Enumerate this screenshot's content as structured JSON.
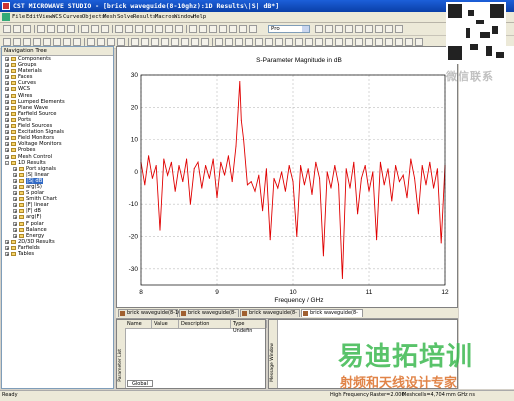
{
  "window": {
    "title": "CST MICROWAVE STUDIO - [brick waveguide(8-10ghz):1D Results\\|S| dB*]"
  },
  "menu": {
    "items": [
      "File",
      "Edit",
      "View",
      "WCS",
      "Curves",
      "Objects",
      "Mesh",
      "Solve",
      "Results",
      "Macros",
      "Window",
      "Help"
    ]
  },
  "toolbar": {
    "selector_value": "Pro"
  },
  "nav": {
    "title": "Navigation Tree",
    "items": [
      {
        "label": "Components",
        "expanded": false,
        "indent": 0,
        "icon": "folder-icon"
      },
      {
        "label": "Groups",
        "expanded": false,
        "indent": 0,
        "icon": "folder-icon"
      },
      {
        "label": "Materials",
        "expanded": false,
        "indent": 0,
        "icon": "folder-icon"
      },
      {
        "label": "Faces",
        "expanded": false,
        "indent": 0,
        "icon": "folder-icon"
      },
      {
        "label": "Curves",
        "expanded": false,
        "indent": 0,
        "icon": "folder-icon"
      },
      {
        "label": "WCS",
        "expanded": false,
        "indent": 0,
        "icon": "folder-icon"
      },
      {
        "label": "Wires",
        "expanded": false,
        "indent": 0,
        "icon": "folder-icon"
      },
      {
        "label": "Lumped Elements",
        "expanded": false,
        "indent": 0,
        "icon": "folder-icon"
      },
      {
        "label": "Plane Wave",
        "expanded": false,
        "indent": 0,
        "icon": "folder-icon"
      },
      {
        "label": "Farfield Source",
        "expanded": false,
        "indent": 0,
        "icon": "folder-icon"
      },
      {
        "label": "Ports",
        "expanded": false,
        "indent": 0,
        "icon": "folder-icon"
      },
      {
        "label": "Field Sources",
        "expanded": false,
        "indent": 0,
        "icon": "folder-icon"
      },
      {
        "label": "Excitation Signals",
        "expanded": false,
        "indent": 0,
        "icon": "folder-icon"
      },
      {
        "label": "Field Monitors",
        "expanded": false,
        "indent": 0,
        "icon": "folder-icon"
      },
      {
        "label": "Voltage Monitors",
        "expanded": false,
        "indent": 0,
        "icon": "folder-icon"
      },
      {
        "label": "Probes",
        "expanded": false,
        "indent": 0,
        "icon": "folder-icon"
      },
      {
        "label": "Mesh Control",
        "expanded": false,
        "indent": 0,
        "icon": "folder-icon"
      },
      {
        "label": "1D Results",
        "expanded": true,
        "indent": 0,
        "icon": "folder-icon"
      },
      {
        "label": "Port signals",
        "expanded": false,
        "indent": 1,
        "icon": "folder-icon"
      },
      {
        "label": "|S| linear",
        "expanded": false,
        "indent": 1,
        "icon": "folder-icon"
      },
      {
        "label": "|S| dB",
        "expanded": false,
        "indent": 1,
        "icon": "folder-icon",
        "selected": true
      },
      {
        "label": "arg(S)",
        "expanded": false,
        "indent": 1,
        "icon": "folder-icon"
      },
      {
        "label": "S polar",
        "expanded": false,
        "indent": 1,
        "icon": "folder-icon"
      },
      {
        "label": "Smith Chart",
        "expanded": false,
        "indent": 1,
        "icon": "folder-icon"
      },
      {
        "label": "|F| linear",
        "expanded": false,
        "indent": 1,
        "icon": "folder-icon"
      },
      {
        "label": "|F| dB",
        "expanded": false,
        "indent": 1,
        "icon": "folder-icon"
      },
      {
        "label": "arg(F)",
        "expanded": false,
        "indent": 1,
        "icon": "folder-icon"
      },
      {
        "label": "F polar",
        "expanded": false,
        "indent": 1,
        "icon": "folder-icon"
      },
      {
        "label": "Balance",
        "expanded": false,
        "indent": 1,
        "icon": "folder-icon"
      },
      {
        "label": "Energy",
        "expanded": false,
        "indent": 1,
        "icon": "folder-icon"
      },
      {
        "label": "2D/3D Results",
        "expanded": false,
        "indent": 0,
        "icon": "folder-icon"
      },
      {
        "label": "Farfields",
        "expanded": false,
        "indent": 0,
        "icon": "folder-icon"
      },
      {
        "label": "Tables",
        "expanded": false,
        "indent": 0,
        "icon": "folder-icon"
      }
    ]
  },
  "chart_data": {
    "type": "line",
    "title": "S-Parameter Magnitude in dB",
    "xlabel": "Frequency / GHz",
    "ylabel": "",
    "xlim": [
      8,
      12
    ],
    "ylim": [
      -35,
      30
    ],
    "xticks": [
      8,
      9,
      10,
      11,
      12
    ],
    "yticks": [
      30,
      20,
      10,
      0,
      -10,
      -20,
      -30
    ],
    "grid": true,
    "series": [
      {
        "color": "#e00000",
        "x": [
          8.0,
          8.05,
          8.1,
          8.15,
          8.2,
          8.25,
          8.3,
          8.35,
          8.4,
          8.45,
          8.5,
          8.55,
          8.6,
          8.65,
          8.7,
          8.75,
          8.8,
          8.85,
          8.9,
          8.95,
          9.0,
          9.05,
          9.1,
          9.15,
          9.2,
          9.25,
          9.28,
          9.3,
          9.32,
          9.35,
          9.4,
          9.45,
          9.5,
          9.55,
          9.6,
          9.65,
          9.7,
          9.75,
          9.8,
          9.85,
          9.9,
          9.95,
          10.0,
          10.05,
          10.1,
          10.15,
          10.2,
          10.25,
          10.3,
          10.35,
          10.4,
          10.45,
          10.5,
          10.55,
          10.6,
          10.65,
          10.7,
          10.75,
          10.8,
          10.85,
          10.9,
          10.95,
          11.0,
          11.05,
          11.1,
          11.15,
          11.2,
          11.25,
          11.3,
          11.35,
          11.4,
          11.45,
          11.5,
          11.55,
          11.6,
          11.65,
          11.7,
          11.75,
          11.8,
          11.85,
          11.9,
          11.95,
          12.0
        ],
        "y": [
          3,
          -4,
          5,
          -2,
          2,
          -18,
          4,
          -1,
          3,
          -6,
          2,
          -3,
          4,
          -10,
          1,
          3,
          -5,
          2,
          -2,
          4,
          -8,
          3,
          -1,
          5,
          -3,
          8,
          20,
          28,
          16,
          10,
          -4,
          -3,
          -6,
          -1,
          -12,
          1,
          -21,
          -2,
          -5,
          0,
          -6,
          2,
          -3,
          -20,
          2,
          -4,
          1,
          -7,
          3,
          -2,
          -26,
          0,
          -5,
          2,
          -4,
          -33,
          1,
          -5,
          3,
          -13,
          -2,
          2,
          -6,
          0,
          -21,
          3,
          -4,
          1,
          -9,
          2,
          -3,
          -1,
          -8,
          4,
          -2,
          -13,
          2,
          -4,
          3,
          -5,
          1,
          -22,
          2
        ]
      }
    ]
  },
  "tabs": {
    "items": [
      {
        "label": "brick waveguide(8-10gh"
      },
      {
        "label": "brick waveguide(8-"
      },
      {
        "label": "brick waveguide(8-"
      },
      {
        "label": "brick waveguide(8-"
      }
    ]
  },
  "params": {
    "side_label": "Parameter List",
    "headers": [
      "Name",
      "Value",
      "Description",
      "Type"
    ],
    "row": [
      "",
      "",
      "",
      "Undefin"
    ],
    "global_tab": "Global"
  },
  "messages": {
    "side_label": "Message Window"
  },
  "status": {
    "left": "Ready",
    "freq": "High Frequency",
    "raster": "Raster=2.000",
    "mesh": "Meshcells=4,704",
    "units": "mm   GHz   ns"
  },
  "watermark": {
    "top": "微信联系",
    "brand": "易迪拓培训",
    "slogan": "射频和天线设计专家"
  }
}
